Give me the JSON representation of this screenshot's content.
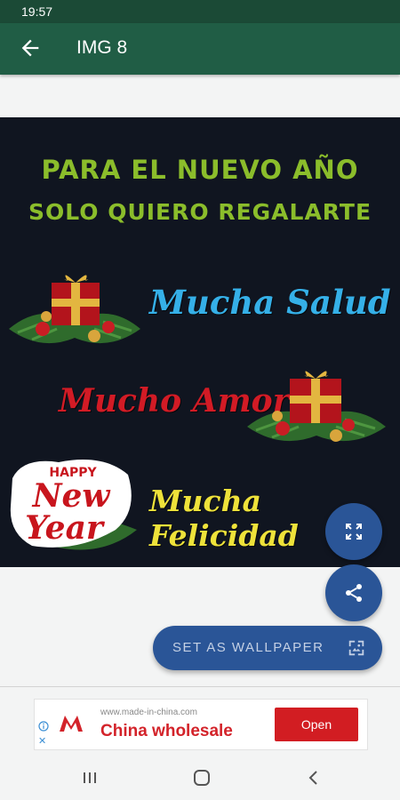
{
  "status_bar": {
    "time": "19:57"
  },
  "app_bar": {
    "title": "IMG 8",
    "back_icon": "arrow-back-icon"
  },
  "image": {
    "headline_1": "PARA EL NUEVO AÑO",
    "headline_2": "SOLO QUIERO REGALARTE",
    "wish_1": "Mucha Salud",
    "wish_2": "Mucho Amor",
    "wish_3": "Mucha Felicidad",
    "badge_happy": "HAPPY",
    "badge_new": "New",
    "badge_year": "Year",
    "colors": {
      "headline": "#8bbd2b",
      "wish_1": "#35b0e8",
      "wish_2": "#d21b25",
      "wish_3": "#eee23a"
    }
  },
  "actions": {
    "expand_icon": "fullscreen-icon",
    "share_icon": "share-icon",
    "set_wallpaper_label": "SET AS WALLPAPER",
    "wallpaper_icon": "wallpaper-icon",
    "accent_color": "#2a5597"
  },
  "ad": {
    "url": "www.made-in-china.com",
    "headline": "China wholesale",
    "cta": "Open",
    "close": "✕"
  },
  "nav_bar": {
    "icons": [
      "recents-icon",
      "home-icon",
      "back-icon"
    ]
  }
}
